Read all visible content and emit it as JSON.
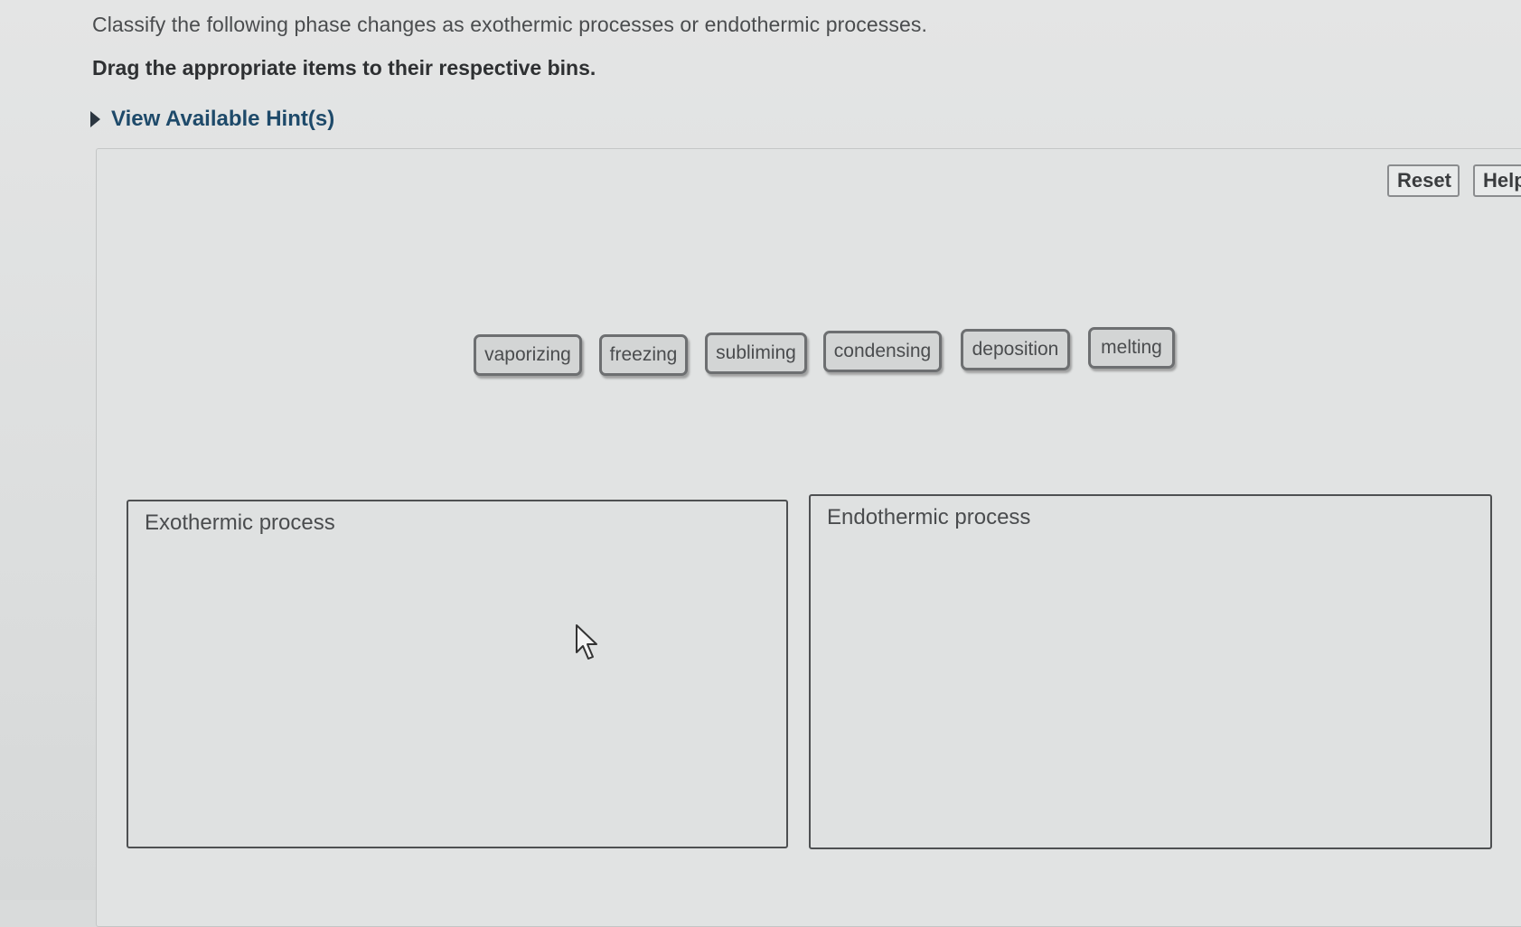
{
  "question": {
    "instruction": "Classify the following phase changes as exothermic processes or endothermic processes.",
    "drag_instruction": "Drag the appropriate items to their respective bins.",
    "hint_label": "View Available Hint(s)"
  },
  "toolbar": {
    "reset_label": "Reset",
    "help_label": "Help"
  },
  "items": [
    "vaporizing",
    "freezing",
    "subliming",
    "condensing",
    "deposition",
    "melting"
  ],
  "bins": {
    "exothermic": {
      "title": "Exothermic process"
    },
    "endothermic": {
      "title": "Endothermic process"
    }
  }
}
